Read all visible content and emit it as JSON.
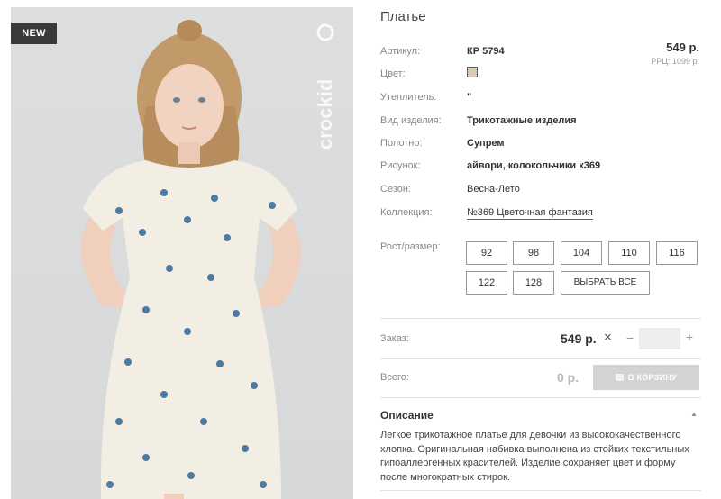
{
  "photo": {
    "badge": "NEW",
    "brand_logo_text": "crockid",
    "colors": {
      "background": "#d9dbdd",
      "dress": "#f2ede2",
      "flower_print": "#4d7aa0"
    }
  },
  "product": {
    "title": "Платье",
    "price": "549 р.",
    "rrp": "РРЦ: 1099 р.",
    "attributes": [
      {
        "label": "Артикул:",
        "value": "КР 5794"
      },
      {
        "label": "Цвет:",
        "value": "",
        "swatch_color": "#d8cdb0"
      },
      {
        "label": "Утеплитель:",
        "value": "\""
      },
      {
        "label": "Вид изделия:",
        "value": "Трикотажные изделия"
      },
      {
        "label": "Полотно:",
        "value": "Супрем"
      },
      {
        "label": "Рисунок:",
        "value": "айвори, колокольчики к369"
      },
      {
        "label": "Сезон:",
        "value": "Весна-Лето"
      },
      {
        "label": "Коллекция:",
        "value": "№369 Цветочная фантазия"
      }
    ],
    "size_label": "Рост/размер:",
    "sizes": [
      "92",
      "98",
      "104",
      "110",
      "116",
      "122",
      "128"
    ],
    "select_all": "ВЫБРАТЬ ВСЕ"
  },
  "order": {
    "label": "Заказ:",
    "price": "549 р.",
    "times": "×",
    "minus": "−",
    "plus": "+",
    "quantity": ""
  },
  "total": {
    "label": "Всего:",
    "value": "0 р.",
    "cart_button": "В КОРЗИНУ"
  },
  "description": {
    "title": "Описание",
    "toggle": "▲",
    "text": "Легкое трикотажное платье для девочки из высококачественного хлопка. Оригинальная набивка выполнена из стойких текстильных гипоаллергенных красителей. Изделие сохраняет цвет и форму после многократных стирок."
  }
}
